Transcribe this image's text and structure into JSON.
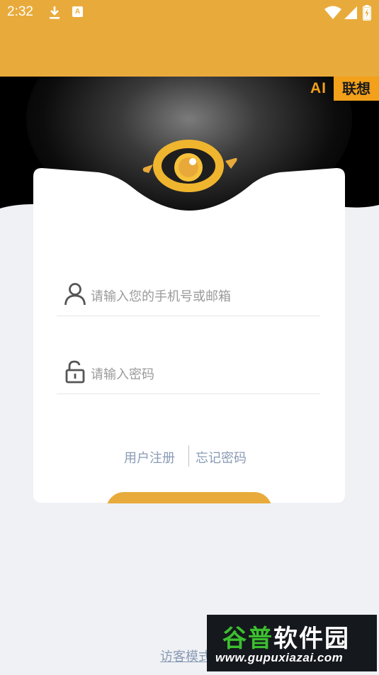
{
  "status_bar": {
    "time": "2:32",
    "download_icon": "download-icon",
    "notification_icon": "a-notification-icon",
    "notification_letter": "A",
    "wifi_icon": "wifi-icon",
    "signal_icon": "signal-icon",
    "battery_icon": "battery-charging-icon"
  },
  "brand": {
    "ai_label": "AI",
    "name": "联想",
    "accent_color": "#f3a01a"
  },
  "logo": {
    "icon": "eye-logo-icon",
    "color": "#f0b52e"
  },
  "login_form": {
    "account_placeholder": "请输入您的手机号或邮箱",
    "password_placeholder": "请输入密码",
    "account_icon": "user-icon",
    "password_icon": "lock-icon"
  },
  "links": {
    "register": "用户注册",
    "forgot_password": "忘记密码"
  },
  "guest_mode": "访客模式",
  "watermark": {
    "brand_green": "谷普",
    "brand_white": "软件园",
    "url": "www.gupuxiazai.com"
  },
  "colors": {
    "header": "#e8ab3b",
    "link": "#8a9bb4",
    "background": "#eff1f5"
  }
}
